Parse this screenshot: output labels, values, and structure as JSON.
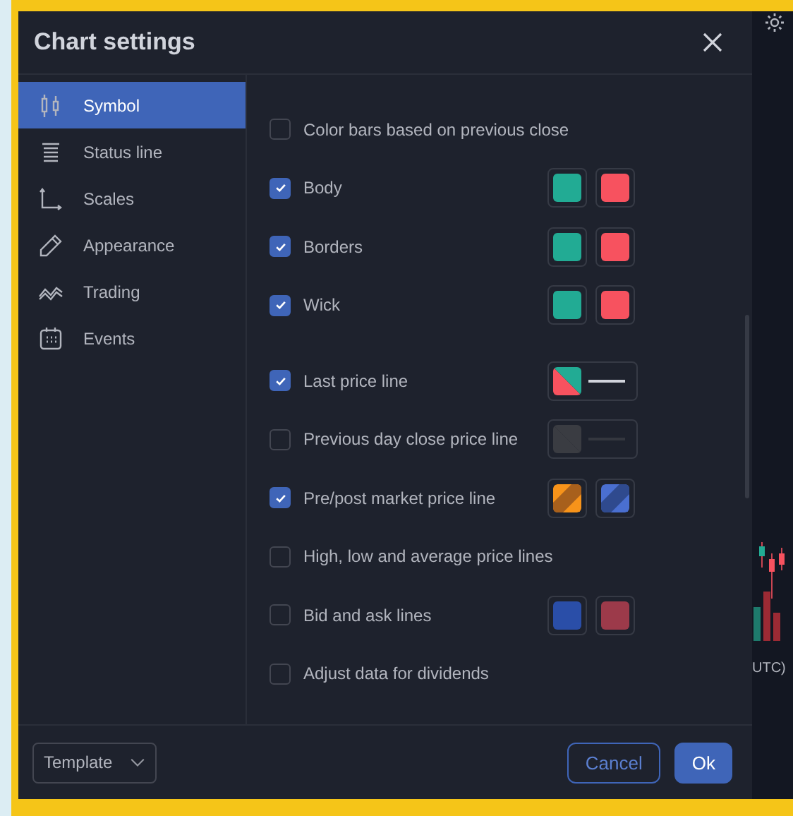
{
  "dialog": {
    "title": "Chart settings",
    "sidebar": {
      "items": [
        {
          "label": "Symbol",
          "selected": true
        },
        {
          "label": "Status line",
          "selected": false
        },
        {
          "label": "Scales",
          "selected": false
        },
        {
          "label": "Appearance",
          "selected": false
        },
        {
          "label": "Trading",
          "selected": false
        },
        {
          "label": "Events",
          "selected": false
        }
      ]
    },
    "sections": [
      {
        "options": [
          {
            "label": "Color bars based on previous close",
            "checked": false
          },
          {
            "label": "Body",
            "checked": true,
            "swatches": [
              {
                "kind": "solid",
                "color": "#22ab94"
              },
              {
                "kind": "solid",
                "color": "#f7525f"
              }
            ]
          },
          {
            "label": "Borders",
            "checked": true,
            "swatches": [
              {
                "kind": "solid",
                "color": "#22ab94"
              },
              {
                "kind": "solid",
                "color": "#f7525f"
              }
            ]
          },
          {
            "label": "Wick",
            "checked": true,
            "swatches": [
              {
                "kind": "solid",
                "color": "#22ab94"
              },
              {
                "kind": "solid",
                "color": "#f7525f"
              }
            ]
          }
        ]
      },
      {
        "options": [
          {
            "label": "Last price line",
            "checked": true,
            "swatches": [
              {
                "kind": "split-line",
                "parts": [
                  {
                    "color": "#f7525f"
                  },
                  {
                    "color": "#22ab94"
                  },
                  {
                    "color": "#d1d4dc"
                  }
                ]
              }
            ]
          },
          {
            "label": "Previous day close price line",
            "checked": false,
            "swatches": [
              {
                "kind": "split-line",
                "parts": [
                  {
                    "color": "#3a3c42"
                  },
                  {
                    "color": "#3a3c42"
                  },
                  {
                    "color": "#34373f"
                  }
                ]
              }
            ]
          },
          {
            "label": "Pre/post market price line",
            "checked": true,
            "swatches": [
              {
                "kind": "band",
                "parts": [
                  {
                    "color": "#f7931a"
                  },
                  {
                    "color": "#a8601c"
                  }
                ]
              },
              {
                "kind": "band",
                "parts": [
                  {
                    "color": "#4a6fd0"
                  },
                  {
                    "color": "#2f4a8e"
                  }
                ]
              }
            ]
          },
          {
            "label": "High, low and average price lines",
            "checked": false
          },
          {
            "label": "Bid and ask lines",
            "checked": false,
            "swatches": [
              {
                "kind": "solid",
                "color": "#2a4ea8"
              },
              {
                "kind": "solid",
                "color": "#9c3a4a"
              }
            ]
          },
          {
            "label": "Adjust data for dividends",
            "checked": false
          }
        ]
      }
    ],
    "footer": {
      "template": "Template",
      "cancel": "Cancel",
      "ok": "Ok"
    }
  },
  "background_chart": {
    "axis_label": "UTC)"
  }
}
